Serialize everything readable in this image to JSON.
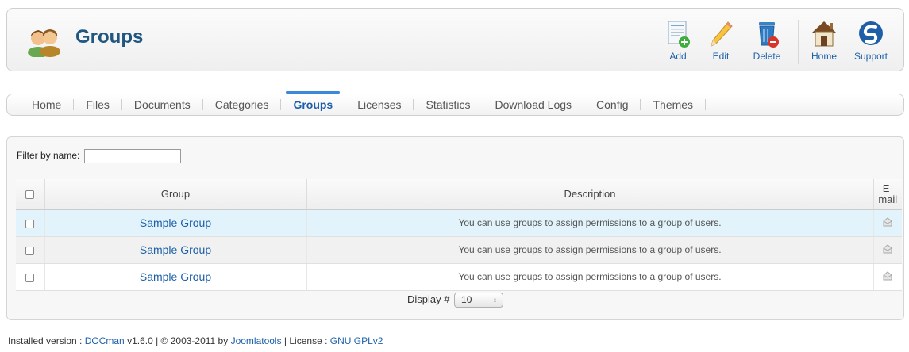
{
  "header": {
    "title": "Groups",
    "icon": "users-icon",
    "toolbar": [
      {
        "label": "Add",
        "icon": "add-document-icon"
      },
      {
        "label": "Edit",
        "icon": "pencil-icon"
      },
      {
        "label": "Delete",
        "icon": "trash-icon"
      },
      {
        "label": "Home",
        "icon": "home-icon"
      },
      {
        "label": "Support",
        "icon": "support-logo-icon"
      }
    ]
  },
  "submenu": {
    "items": [
      "Home",
      "Files",
      "Documents",
      "Categories",
      "Groups",
      "Licenses",
      "Statistics",
      "Download Logs",
      "Config",
      "Themes"
    ],
    "active": "Groups"
  },
  "filter": {
    "label": "Filter by name:",
    "value": ""
  },
  "table": {
    "columns": [
      "Group",
      "Description",
      "E-mail"
    ],
    "rows": [
      {
        "group": "Sample Group",
        "description": "You can use groups to assign permissions to a group of users."
      },
      {
        "group": "Sample Group",
        "description": "You can use groups to assign permissions to a group of users."
      },
      {
        "group": "Sample Group",
        "description": "You can use groups to assign permissions to a group of users."
      }
    ]
  },
  "pagination": {
    "label": "Display #",
    "value": "10"
  },
  "footer": {
    "prefix": "Installed version : ",
    "product": "DOCman",
    "version_copy": " v1.6.0 | © 2003-2011 by ",
    "company": "Joomlatools",
    "license_label": " | License : ",
    "license": "GNU GPLv2"
  },
  "colors": {
    "accent": "#1c5fa8",
    "title": "#20567f",
    "highlight_row": "#e2f3fb"
  }
}
